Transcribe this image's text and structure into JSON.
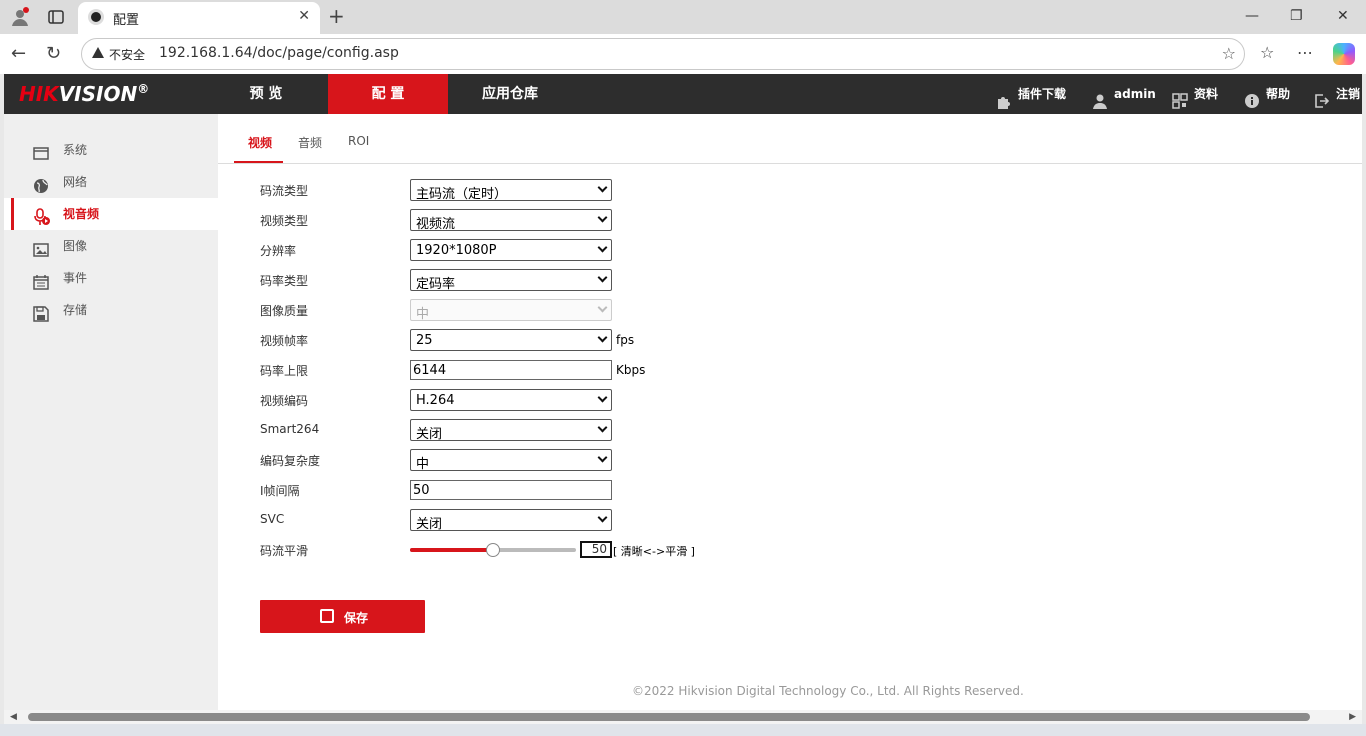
{
  "browser": {
    "tab_title": "配置",
    "insecure_label": "不安全",
    "url": "192.168.1.64/doc/page/config.asp"
  },
  "header": {
    "logo_hik": "HIK",
    "logo_vision": "VISION",
    "logo_reg": "®",
    "menu": [
      "预 览",
      "配 置",
      "应用仓库"
    ],
    "active_menu": 1,
    "plugin_download": "插件下载",
    "user": "admin",
    "docs": "资料",
    "help": "帮助",
    "logout": "注销"
  },
  "sidebar": {
    "items": [
      {
        "label": "系统",
        "icon": "monitor-icon"
      },
      {
        "label": "网络",
        "icon": "globe-icon"
      },
      {
        "label": "视音频",
        "icon": "microphone-icon"
      },
      {
        "label": "图像",
        "icon": "image-icon"
      },
      {
        "label": "事件",
        "icon": "calendar-icon"
      },
      {
        "label": "存储",
        "icon": "floppy-icon"
      }
    ],
    "active": 2
  },
  "subtabs": {
    "video": "视频",
    "audio": "音频",
    "roi": "ROI"
  },
  "form": {
    "stream_type": {
      "label": "码流类型",
      "value": "主码流（定时）"
    },
    "video_type": {
      "label": "视频类型",
      "value": "视频流"
    },
    "resolution": {
      "label": "分辨率",
      "value": "1920*1080P"
    },
    "bitrate_type": {
      "label": "码率类型",
      "value": "定码率"
    },
    "image_quality": {
      "label": "图像质量",
      "value": "中"
    },
    "frame_rate": {
      "label": "视频帧率",
      "value": "25",
      "unit": "fps"
    },
    "max_bitrate": {
      "label": "码率上限",
      "value": "6144",
      "unit": "Kbps"
    },
    "video_encoding": {
      "label": "视频编码",
      "value": "H.264"
    },
    "smart264": {
      "label": "Smart264",
      "value": "关闭"
    },
    "complexity": {
      "label": "编码复杂度",
      "value": "中"
    },
    "i_frame_interval": {
      "label": "I帧间隔",
      "value": "50"
    },
    "svc": {
      "label": "SVC",
      "value": "关闭"
    },
    "smoothing": {
      "label": "码流平滑",
      "value": "50",
      "level": 0.5,
      "hint": "[ 清晰<->平滑 ]"
    }
  },
  "save_button": "保存",
  "footer": "©2022 Hikvision Digital Technology Co., Ltd. All Rights Reserved.",
  "colors": {
    "accent": "#d7151b",
    "header_bg": "#2d2d2d"
  }
}
